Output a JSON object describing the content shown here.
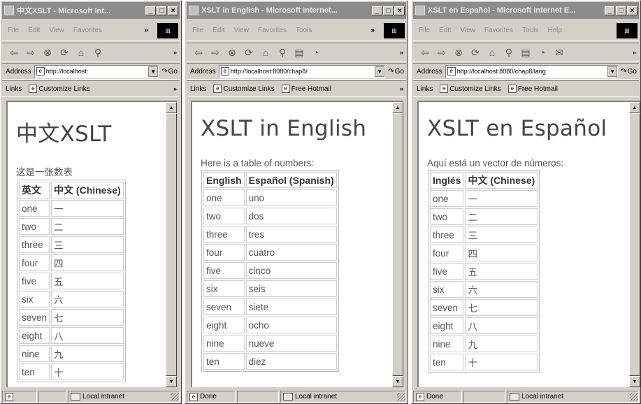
{
  "windows": [
    {
      "title": "中文XSLT - Microsoft Int...",
      "menu": [
        "File",
        "Edit",
        "View",
        "Favorites"
      ],
      "address": "http://localhost:",
      "go": "Go",
      "links": [
        "Customize Links"
      ],
      "heading": "中文XSLT",
      "intro": "这是一张数表",
      "headers": [
        "英文",
        "中文 (Chinese)"
      ],
      "rows": [
        [
          "one",
          "一"
        ],
        [
          "two",
          "二"
        ],
        [
          "three",
          "三"
        ],
        [
          "four",
          "四"
        ],
        [
          "five",
          "五"
        ],
        [
          "six",
          "六"
        ],
        [
          "seven",
          "七"
        ],
        [
          "eight",
          "八"
        ],
        [
          "nine",
          "九"
        ],
        [
          "ten",
          "十"
        ]
      ],
      "status": "",
      "zone": "Local intranet"
    },
    {
      "title": "XSLT in English - Microsoft Internet...",
      "menu": [
        "File",
        "Edit",
        "View",
        "Favorites",
        "Tools"
      ],
      "address": "http://localhost:8080/chap8/",
      "go": "Go",
      "links": [
        "Customize Links",
        "Free Hotmail"
      ],
      "heading": "XSLT in English",
      "intro": "Here is a table of numbers:",
      "headers": [
        "English",
        "Español (Spanish)"
      ],
      "rows": [
        [
          "one",
          "uno"
        ],
        [
          "two",
          "dos"
        ],
        [
          "three",
          "tres"
        ],
        [
          "four",
          "cuatro"
        ],
        [
          "five",
          "cinco"
        ],
        [
          "six",
          "seis"
        ],
        [
          "seven",
          "siete"
        ],
        [
          "eight",
          "ocho"
        ],
        [
          "nine",
          "nueve"
        ],
        [
          "ten",
          "diez"
        ]
      ],
      "status": "Done",
      "zone": "Local intranet"
    },
    {
      "title": "XSLT en Español - Microsoft Internet E...",
      "menu": [
        "File",
        "Edit",
        "View",
        "Favorites",
        "Tools",
        "Help"
      ],
      "address": "http://localhost:8080/chap8/lang",
      "go": "Go",
      "links": [
        "Customize Links",
        "Free Hotmail"
      ],
      "heading": "XSLT en Español",
      "intro": "Aquí está un vector de números:",
      "headers": [
        "Inglés",
        "中文 (Chinese)"
      ],
      "rows": [
        [
          "one",
          "一"
        ],
        [
          "two",
          "二"
        ],
        [
          "three",
          "三"
        ],
        [
          "four",
          "四"
        ],
        [
          "five",
          "五"
        ],
        [
          "six",
          "六"
        ],
        [
          "seven",
          "七"
        ],
        [
          "eight",
          "八"
        ],
        [
          "nine",
          "九"
        ],
        [
          "ten",
          "十"
        ]
      ],
      "status": "Done",
      "zone": "Local intranet"
    }
  ],
  "labels": {
    "address": "Address",
    "links": "Links"
  }
}
